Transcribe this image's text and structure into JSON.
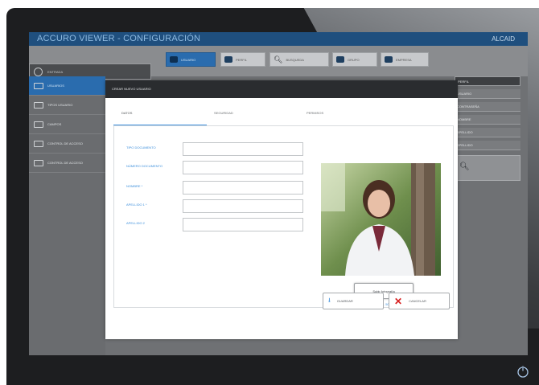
{
  "app": {
    "title": "ACCURO VIEWER - CONFIGURACIÓN",
    "user": "ALCAID"
  },
  "top_field": {
    "label": "ENTRADA"
  },
  "toolbar": [
    {
      "label": "USUARIO",
      "icon": "users-icon",
      "active": true
    },
    {
      "label": "PERFIL",
      "icon": "users-icon",
      "active": false
    },
    {
      "label": "BUSQUEDA",
      "icon": "search-icon",
      "active": false
    },
    {
      "label": "GRUPO",
      "icon": "users-icon",
      "active": false
    },
    {
      "label": "EMPRESA",
      "icon": "user-icon",
      "active": false
    }
  ],
  "sidebar": [
    {
      "label": "USUARIOS",
      "active": true
    },
    {
      "label": "TIPOS USUARIO",
      "active": false
    },
    {
      "label": "CAMPOS",
      "active": false
    },
    {
      "label": "CONTROL DE ACCESO",
      "active": false
    },
    {
      "label": "CONTROL DE ACCESO",
      "active": false
    }
  ],
  "right_panel": {
    "header": "PERFIL",
    "items": [
      "USUARIO",
      "CONTRASEÑA",
      "NOMBRE",
      "APELLIDO",
      "APELLIDO"
    ]
  },
  "modal": {
    "title": "CREAR NUEVO USUARIO",
    "tabs": [
      "DATOS",
      "SEGURIDAD",
      "PERMISOS"
    ],
    "fields": [
      {
        "label": "TIPO DOCUMENTO",
        "value": ""
      },
      {
        "label": "NÚMERO DOCUMENTO",
        "value": ""
      },
      {
        "label": "NOMBRE *",
        "value": ""
      },
      {
        "label": "APELLIDO 1 *",
        "value": ""
      },
      {
        "label": "APELLIDO 2",
        "value": ""
      }
    ],
    "photo_button": "Subir fotografía",
    "photo_note": "tamaño max. 500Kb",
    "save_label": "GUARDAR",
    "cancel_label": "CANCELAR"
  },
  "colors": {
    "accent": "#2a6cae",
    "title_bar": "#1f4f7e",
    "link": "#3c8fdc",
    "cancel": "#d71f1f"
  }
}
